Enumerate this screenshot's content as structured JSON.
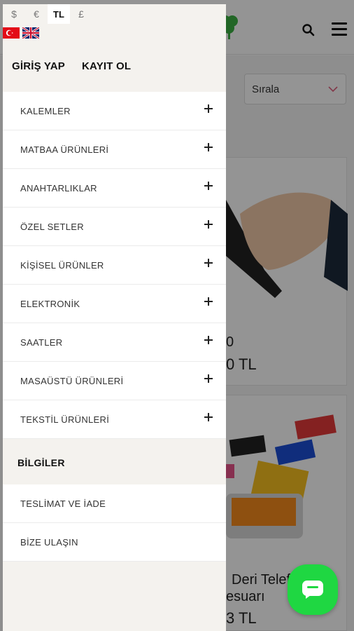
{
  "drawer": {
    "currencies": [
      {
        "symbol": "$",
        "active": false
      },
      {
        "symbol": "€",
        "active": false
      },
      {
        "symbol": "TL",
        "active": true
      },
      {
        "symbol": "£",
        "active": false
      }
    ],
    "flags": [
      "turkey-flag-icon",
      "uk-flag-icon"
    ],
    "auth": {
      "login": "GİRİŞ YAP",
      "register": "KAYIT OL"
    },
    "categories": [
      "KALEMLER",
      "MATBAA ÜRÜNLERİ",
      "ANAHTARLIKLAR",
      "ÖZEL SETLER",
      "KİŞİSEL ÜRÜNLER",
      "ELEKTRONİK",
      "SAATLER",
      "MASAÜSTÜ ÜRÜNLERİ",
      "TEKSTİL ÜRÜNLERİ"
    ],
    "info_title": "BİLGİLER",
    "info_links": [
      "TESLİMAT VE İADE",
      "BİZE ULAŞIN"
    ]
  },
  "background": {
    "sort_label": "Sırala",
    "card1_line1": "0",
    "card1_price": "0 TL",
    "card2_line1": "Deri Telef",
    "card2_line2": "esuarı",
    "card2_price": "3 TL"
  },
  "colors": {
    "accent_green": "#1fd742",
    "sort_chevron": "#e0607e"
  }
}
